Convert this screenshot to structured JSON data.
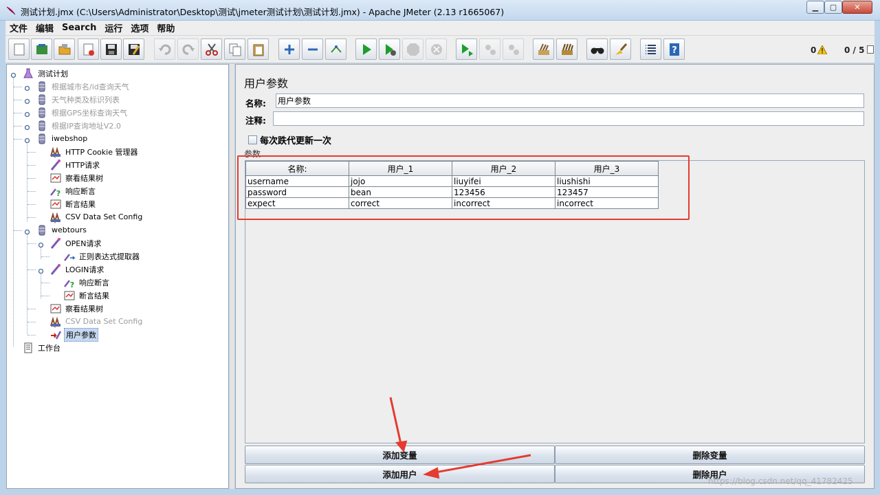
{
  "window": {
    "title": "测试计划.jmx (C:\\Users\\Administrator\\Desktop\\测试\\jmeter测试计划\\测试计划.jmx) - Apache JMeter (2.13 r1665067)"
  },
  "menu": [
    "文件",
    "编辑",
    "Search",
    "运行",
    "选项",
    "帮助"
  ],
  "toolbar": {
    "buttons": [
      "new-icon",
      "templates-icon",
      "open-icon",
      "close-icon",
      "save-icon",
      "save-as-icon",
      "undo-icon",
      "redo-icon",
      "cut-icon",
      "copy-icon",
      "paste-icon",
      "expand-icon",
      "collapse-icon",
      "toggle-icon",
      "start-icon",
      "start-no-pause-icon",
      "stop-icon",
      "shutdown-icon",
      "remote-start-icon",
      "remote-stop-icon",
      "remote-shutdown-icon",
      "clear-icon",
      "clear-all-icon",
      "search-icon",
      "reset-search-icon",
      "function-helper-icon",
      "help-icon"
    ],
    "errors": "0",
    "threads": "0 / 5"
  },
  "tree": {
    "items": [
      {
        "label": "测试计划",
        "level": 0,
        "icon": "test-plan-icon",
        "disabled": false
      },
      {
        "label": "根据城市名/id查询天气",
        "level": 1,
        "icon": "thread-group-icon",
        "disabled": true
      },
      {
        "label": "天气种类及标识列表",
        "level": 1,
        "icon": "thread-group-icon",
        "disabled": true
      },
      {
        "label": "根据GPS坐标查询天气",
        "level": 1,
        "icon": "thread-group-icon",
        "disabled": true
      },
      {
        "label": "根据IP查询地址V2.0",
        "level": 1,
        "icon": "thread-group-icon",
        "disabled": true
      },
      {
        "label": "iwebshop",
        "level": 1,
        "icon": "thread-group-icon",
        "disabled": false
      },
      {
        "label": "HTTP Cookie 管理器",
        "level": 2,
        "icon": "cookie-manager-icon",
        "disabled": false
      },
      {
        "label": "HTTP请求",
        "level": 2,
        "icon": "sampler-icon",
        "disabled": false
      },
      {
        "label": "察看结果树",
        "level": 2,
        "icon": "listener-icon",
        "disabled": false
      },
      {
        "label": "响应断言",
        "level": 2,
        "icon": "assertion-icon",
        "disabled": false
      },
      {
        "label": "断言结果",
        "level": 2,
        "icon": "listener-icon",
        "disabled": false
      },
      {
        "label": "CSV Data Set Config",
        "level": 2,
        "icon": "config-icon",
        "disabled": false
      },
      {
        "label": "webtours",
        "level": 1,
        "icon": "thread-group-icon",
        "disabled": false
      },
      {
        "label": "OPEN请求",
        "level": 2,
        "icon": "sampler-icon",
        "disabled": false
      },
      {
        "label": "正则表达式提取器",
        "level": 3,
        "icon": "extractor-icon",
        "disabled": false
      },
      {
        "label": "LOGIN请求",
        "level": 2,
        "icon": "sampler-icon",
        "disabled": false
      },
      {
        "label": "响应断言",
        "level": 3,
        "icon": "assertion-icon",
        "disabled": false
      },
      {
        "label": "断言结果",
        "level": 3,
        "icon": "listener-icon",
        "disabled": false
      },
      {
        "label": "察看结果树",
        "level": 2,
        "icon": "listener-icon",
        "disabled": false
      },
      {
        "label": "CSV Data Set Config",
        "level": 2,
        "icon": "config-icon",
        "disabled": true
      },
      {
        "label": "用户参数",
        "level": 2,
        "icon": "preprocessor-icon",
        "disabled": false,
        "selected": true
      },
      {
        "label": "工作台",
        "level": 0,
        "icon": "workbench-icon",
        "disabled": false
      }
    ]
  },
  "panel": {
    "title": "用户参数",
    "name_label": "名称:",
    "name_value": "用户参数",
    "comment_label": "注释:",
    "comment_value": "",
    "checkbox_label": "每次跌代更新一次",
    "section_label": "参数"
  },
  "table": {
    "headers": [
      "名称:",
      "用户_1",
      "用户_2",
      "用户_3"
    ],
    "rows": [
      [
        "username",
        "jojo",
        "liuyifei",
        "liushishi"
      ],
      [
        "password",
        "bean",
        "123456",
        "123457"
      ],
      [
        "expect",
        "correct",
        "incorrect",
        "incorrect"
      ]
    ]
  },
  "buttons": {
    "add_variable": "添加变量",
    "delete_variable": "删除变量",
    "add_user": "添加用户",
    "delete_user": "删除用户"
  },
  "annotation_color": "#e53b30",
  "watermark": "https://blog.csdn.net/qq_41782425"
}
